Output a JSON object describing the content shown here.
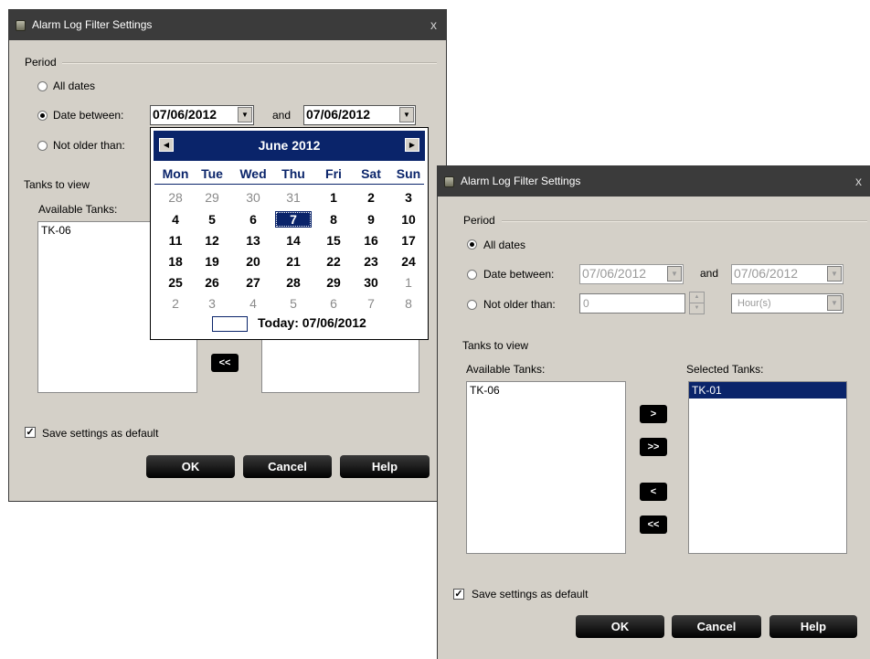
{
  "dialog_back": {
    "title": "Alarm Log Filter Settings",
    "close": "x",
    "period_label": "Period",
    "radio_all_dates": "All dates",
    "radio_date_between": "Date between:",
    "date_from": "07/06/2012",
    "and_label": "and",
    "date_to": "07/06/2012",
    "radio_not_older": "Not older than:",
    "tanks_label": "Tanks to view",
    "available_label": "Available Tanks:",
    "available_tanks": [
      "TK-06"
    ],
    "remove_all_label": "<<",
    "save_default_label": "Save settings as default",
    "ok": "OK",
    "cancel": "Cancel",
    "help": "Help"
  },
  "calendar": {
    "month": "June 2012",
    "days_of_week": [
      "Mon",
      "Tue",
      "Wed",
      "Thu",
      "Fri",
      "Sat",
      "Sun"
    ],
    "weeks": [
      [
        "28",
        "29",
        "30",
        "31",
        "1",
        "2",
        "3"
      ],
      [
        "4",
        "5",
        "6",
        "7",
        "8",
        "9",
        "10"
      ],
      [
        "11",
        "12",
        "13",
        "14",
        "15",
        "16",
        "17"
      ],
      [
        "18",
        "19",
        "20",
        "21",
        "22",
        "23",
        "24"
      ],
      [
        "25",
        "26",
        "27",
        "28",
        "29",
        "30",
        "1"
      ],
      [
        "2",
        "3",
        "4",
        "5",
        "6",
        "7",
        "8"
      ]
    ],
    "selected_day": "7",
    "today_text": "Today: 07/06/2012"
  },
  "dialog_front": {
    "title": "Alarm Log Filter Settings",
    "close": "x",
    "period_label": "Period",
    "radio_all_dates": "All dates",
    "radio_date_between": "Date between:",
    "date_from": "07/06/2012",
    "and_label": "and",
    "date_to": "07/06/2012",
    "radio_not_older": "Not older than:",
    "not_older_value": "0",
    "unit_value": "Hour(s)",
    "selected_radio": "All dates",
    "tanks_label": "Tanks to view",
    "available_label": "Available Tanks:",
    "selected_label": "Selected Tanks:",
    "available_tanks": [
      "TK-06"
    ],
    "selected_tanks": [
      "TK-01"
    ],
    "add_label": ">",
    "add_all_label": ">>",
    "remove_label": "<",
    "remove_all_label": "<<",
    "save_default_label": "Save settings as default",
    "save_default_checked": true,
    "ok": "OK",
    "cancel": "Cancel",
    "help": "Help"
  },
  "colors": {
    "titlebar": "#3b3b3b",
    "dialog_bg": "#d4d0c8",
    "calendar_header": "#0a246a",
    "button": "#000000"
  }
}
